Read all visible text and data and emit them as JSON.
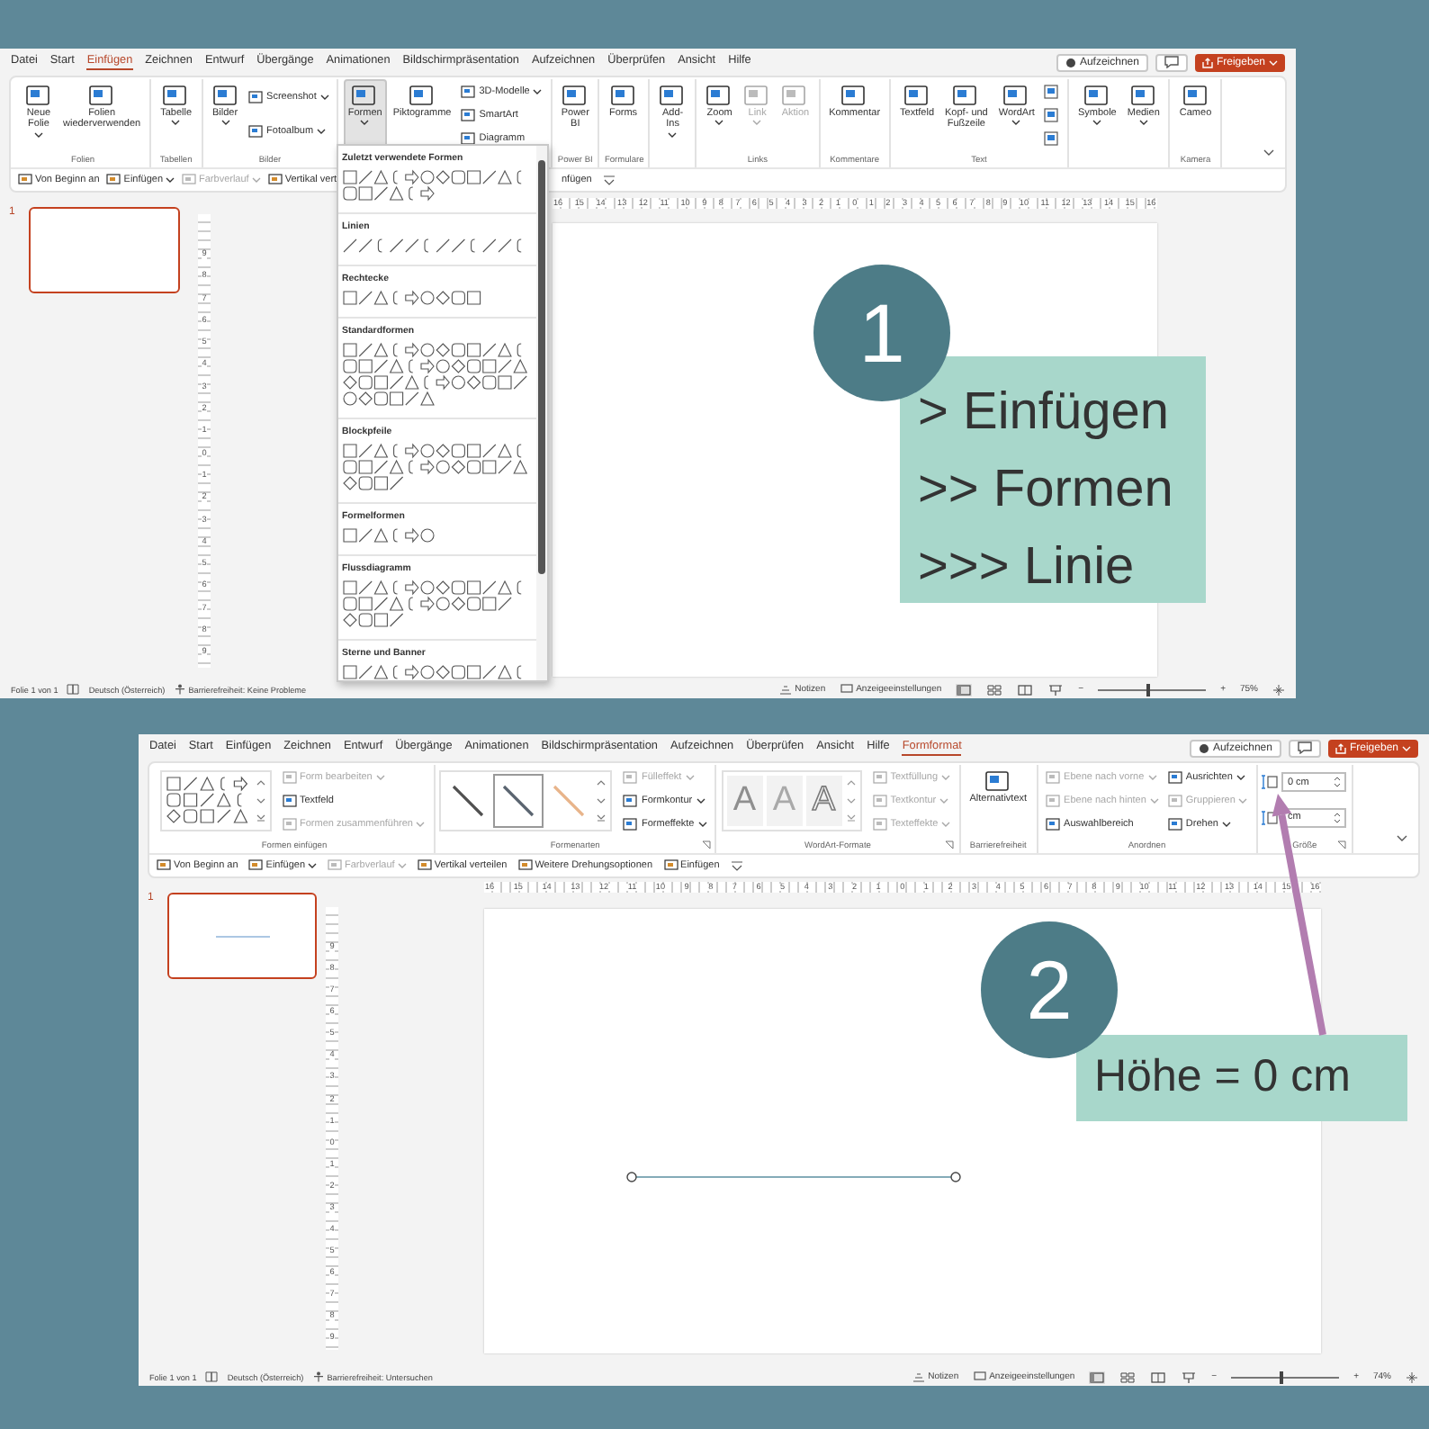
{
  "windows": [
    {
      "tabs": [
        {
          "label": "Datei",
          "selected": false
        },
        {
          "label": "Start",
          "selected": false
        },
        {
          "label": "Einfügen",
          "selected": true
        },
        {
          "label": "Zeichnen",
          "selected": false
        },
        {
          "label": "Entwurf",
          "selected": false
        },
        {
          "label": "Übergänge",
          "selected": false
        },
        {
          "label": "Animationen",
          "selected": false
        },
        {
          "label": "Bildschirmpräsentation",
          "selected": false
        },
        {
          "label": "Aufzeichnen",
          "selected": false
        },
        {
          "label": "Überprüfen",
          "selected": false
        },
        {
          "label": "Ansicht",
          "selected": false
        },
        {
          "label": "Hilfe",
          "selected": false
        }
      ],
      "record_button": "Aufzeichnen",
      "share_button": "Freigeben",
      "groups": [
        {
          "label": "Folien",
          "items": [
            {
              "kind": "large",
              "label": "Neue\nFolie",
              "menu": true,
              "expanded": false,
              "disabled": false
            },
            {
              "kind": "large",
              "label": "Folien\nwiederverwenden",
              "disabled": false
            }
          ]
        },
        {
          "label": "Tabellen",
          "items": [
            {
              "kind": "large",
              "label": "Tabelle",
              "menu": true,
              "expanded": false,
              "disabled": false
            }
          ]
        },
        {
          "label": "Bilder",
          "items": [
            {
              "kind": "large",
              "label": "Bilder",
              "menu": true,
              "expanded": false,
              "disabled": false
            },
            {
              "kind": "stack",
              "items": [
                {
                  "kind": "small",
                  "label": "Screenshot",
                  "menu": true,
                  "expanded": false,
                  "disabled": false
                },
                {
                  "kind": "small",
                  "label": "Fotoalbum",
                  "menu": true,
                  "expanded": false,
                  "disabled": false
                }
              ]
            }
          ]
        },
        {
          "items": [
            {
              "kind": "large",
              "label": "Formen",
              "menu": true,
              "expanded": true,
              "disabled": false
            },
            {
              "kind": "large",
              "label": "Piktogramme",
              "disabled": false
            },
            {
              "kind": "stack",
              "items": [
                {
                  "kind": "small",
                  "label": "3D-Modelle",
                  "menu": true,
                  "expanded": false,
                  "disabled": false
                },
                {
                  "kind": "small",
                  "label": "SmartArt",
                  "disabled": false
                },
                {
                  "kind": "small",
                  "label": "Diagramm",
                  "disabled": false
                }
              ]
            }
          ]
        },
        {
          "label": "Power BI",
          "items": [
            {
              "kind": "large",
              "label": "Power\nBI",
              "disabled": false
            }
          ]
        },
        {
          "label": "Formulare",
          "items": [
            {
              "kind": "large",
              "label": "Forms",
              "disabled": false
            }
          ]
        },
        {
          "items": [
            {
              "kind": "large",
              "label": "Add-\nIns",
              "menu": true,
              "expanded": false,
              "disabled": false
            }
          ]
        },
        {
          "label": "Links",
          "items": [
            {
              "kind": "large",
              "label": "Zoom",
              "menu": true,
              "expanded": false,
              "disabled": false
            },
            {
              "kind": "large",
              "label": "Link",
              "menu": true,
              "expanded": false,
              "disabled": true
            },
            {
              "kind": "large",
              "label": "Aktion",
              "disabled": true
            }
          ]
        },
        {
          "label": "Kommentare",
          "items": [
            {
              "kind": "large",
              "label": "Kommentar",
              "disabled": false
            }
          ]
        },
        {
          "label": "Text",
          "items": [
            {
              "kind": "large",
              "label": "Textfeld",
              "disabled": false
            },
            {
              "kind": "large",
              "label": "Kopf- und\nFußzeile",
              "disabled": false
            },
            {
              "kind": "large",
              "label": "WordArt",
              "menu": true,
              "expanded": false,
              "disabled": false
            },
            {
              "kind": "stack",
              "items": [
                {
                  "kind": "icon",
                  "disabled": false
                },
                {
                  "kind": "icon",
                  "disabled": false
                },
                {
                  "kind": "icon",
                  "disabled": false
                }
              ]
            }
          ]
        },
        {
          "items": [
            {
              "kind": "large",
              "label": "Symbole",
              "menu": true,
              "expanded": false,
              "disabled": false
            },
            {
              "kind": "large",
              "label": "Medien",
              "menu": true,
              "expanded": false,
              "disabled": false
            }
          ]
        },
        {
          "label": "Kamera",
          "items": [
            {
              "kind": "large",
              "label": "Cameo",
              "disabled": false
            }
          ]
        }
      ],
      "quick_access": [
        {
          "label": "Von Beginn an",
          "disabled": false
        },
        {
          "label": "Einfügen",
          "menu": true,
          "disabled": false
        },
        {
          "label": "Farbverlauf",
          "menu": true,
          "disabled": true
        },
        {
          "label": "Vertikal vert",
          "disabled": false
        },
        {
          "label": "nfügen",
          "disabled": false
        }
      ],
      "shapes_menu": {
        "sections": [
          "Zuletzt verwendete Formen",
          "Linien",
          "Rechtecke",
          "Standardformen",
          "Blockpfeile",
          "Formelformen",
          "Flussdiagramm",
          "Sterne und Banner"
        ]
      },
      "slide_number": "1",
      "ruler_h": [
        "16",
        "15",
        "14",
        "13",
        "12",
        "11",
        "10",
        "9",
        "8",
        "7",
        "6",
        "5",
        "4",
        "3",
        "2",
        "1",
        "0",
        "1",
        "2",
        "3",
        "4",
        "5",
        "6",
        "7",
        "8",
        "9",
        "10",
        "11",
        "12",
        "13",
        "14",
        "15",
        "16"
      ],
      "ruler_v": [
        "9",
        "8",
        "7",
        "6",
        "5",
        "4",
        "3",
        "2",
        "1",
        "0",
        "1",
        "2",
        "3",
        "4",
        "5",
        "6",
        "7",
        "8",
        "9"
      ],
      "callout": {
        "number": "1",
        "lines": [
          "> Einfügen",
          ">> Formen",
          ">>> Linie"
        ]
      },
      "status_bar": {
        "slide_info": "Folie 1 von 1",
        "language": "Deutsch (Österreich)",
        "accessibility": "Barrierefreiheit: Keine Probleme",
        "notes": "Notizen",
        "display_settings": "Anzeigeeinstellungen",
        "zoom_out": "−",
        "zoom_in": "+",
        "level": 0.45,
        "zoom": "75%"
      }
    },
    {
      "tabs": [
        {
          "label": "Datei",
          "selected": false
        },
        {
          "label": "Start",
          "selected": false
        },
        {
          "label": "Einfügen",
          "selected": false
        },
        {
          "label": "Zeichnen",
          "selected": false
        },
        {
          "label": "Entwurf",
          "selected": false
        },
        {
          "label": "Übergänge",
          "selected": false
        },
        {
          "label": "Animationen",
          "selected": false
        },
        {
          "label": "Bildschirmpräsentation",
          "selected": false
        },
        {
          "label": "Aufzeichnen",
          "selected": false
        },
        {
          "label": "Überprüfen",
          "selected": false
        },
        {
          "label": "Ansicht",
          "selected": false
        },
        {
          "label": "Hilfe",
          "selected": false
        },
        {
          "label": "Formformat",
          "selected": true
        }
      ],
      "record_button": "Aufzeichnen",
      "share_button": "Freigeben",
      "groups": [
        {
          "label": "Formen einfügen",
          "items": [
            {
              "kind": "gallery"
            },
            {
              "kind": "stack",
              "items": [
                {
                  "kind": "small",
                  "label": "Form bearbeiten",
                  "menu": true,
                  "expanded": false,
                  "disabled": true
                },
                {
                  "kind": "small",
                  "label": "Textfeld",
                  "disabled": false
                },
                {
                  "kind": "small",
                  "label": "Formen zusammenführen",
                  "menu": true,
                  "expanded": false,
                  "disabled": true
                }
              ]
            }
          ]
        },
        {
          "label": "Formenarten",
          "launcher": true,
          "items": [
            {
              "kind": "styles",
              "styles": [
                {
                  "color": "#505050",
                  "selected": false
                },
                {
                  "color": "#5a6470",
                  "selected": true
                },
                {
                  "color": "#e8b48a",
                  "selected": false
                }
              ]
            },
            {
              "kind": "stack",
              "items": [
                {
                  "kind": "small",
                  "label": "Fülleffekt",
                  "menu": true,
                  "expanded": false,
                  "disabled": true
                },
                {
                  "kind": "small",
                  "label": "Formkontur",
                  "menu": true,
                  "expanded": false,
                  "disabled": false
                },
                {
                  "kind": "small",
                  "label": "Formeffekte",
                  "menu": true,
                  "expanded": false,
                  "disabled": false
                }
              ]
            }
          ]
        },
        {
          "label": "WordArt-Formate",
          "launcher": true,
          "items": [
            {
              "kind": "wordart",
              "letters": [
                "A",
                "A",
                "A"
              ],
              "disabled": true
            },
            {
              "kind": "stack",
              "items": [
                {
                  "kind": "small",
                  "label": "Textfüllung",
                  "menu": true,
                  "expanded": false,
                  "disabled": true
                },
                {
                  "kind": "small",
                  "label": "Textkontur",
                  "menu": true,
                  "expanded": false,
                  "disabled": true
                },
                {
                  "kind": "small",
                  "label": "Texteffekte",
                  "menu": true,
                  "expanded": false,
                  "disabled": true
                }
              ]
            }
          ]
        },
        {
          "label": "Barrierefreiheit",
          "items": [
            {
              "kind": "large",
              "label": "Alternativtext",
              "disabled": false
            }
          ]
        },
        {
          "label": "Anordnen",
          "items": [
            {
              "kind": "stack",
              "items": [
                {
                  "kind": "small",
                  "label": "Ebene nach vorne",
                  "menu": true,
                  "expanded": false,
                  "disabled": true
                },
                {
                  "kind": "small",
                  "label": "Ebene nach hinten",
                  "menu": true,
                  "expanded": false,
                  "disabled": true
                },
                {
                  "kind": "small",
                  "label": "Auswahlbereich",
                  "disabled": false
                }
              ]
            },
            {
              "kind": "stack",
              "items": [
                {
                  "kind": "small",
                  "label": "Ausrichten",
                  "menu": true,
                  "expanded": false,
                  "disabled": false
                },
                {
                  "kind": "small",
                  "label": "Gruppieren",
                  "menu": true,
                  "expanded": false,
                  "disabled": true
                },
                {
                  "kind": "small",
                  "label": "Drehen",
                  "menu": true,
                  "expanded": false,
                  "disabled": false
                }
              ]
            }
          ]
        },
        {
          "label": "Größe",
          "launcher": true,
          "items": [
            {
              "kind": "stack",
              "items": [
                {
                  "kind": "field",
                  "value": "0 cm"
                },
                {
                  "kind": "field",
                  "value": "cm"
                }
              ]
            }
          ]
        }
      ],
      "quick_access": [
        {
          "label": "Von Beginn an",
          "disabled": false
        },
        {
          "label": "Einfügen",
          "menu": true,
          "disabled": false
        },
        {
          "label": "Farbverlauf",
          "menu": true,
          "disabled": true
        },
        {
          "label": "Vertikal verteilen",
          "disabled": false
        },
        {
          "label": "Weitere Drehungsoptionen",
          "disabled": false
        },
        {
          "label": "Einfügen",
          "disabled": false
        }
      ],
      "slide_number": "1",
      "ruler_h": [
        "16",
        "15",
        "14",
        "13",
        "12",
        "11",
        "10",
        "9",
        "8",
        "7",
        "6",
        "5",
        "4",
        "3",
        "2",
        "1",
        "0",
        "1",
        "2",
        "3",
        "4",
        "5",
        "6",
        "7",
        "8",
        "9",
        "10",
        "11",
        "12",
        "13",
        "14",
        "15",
        "16"
      ],
      "ruler_v": [
        "9",
        "8",
        "7",
        "6",
        "5",
        "4",
        "3",
        "2",
        "1",
        "0",
        "1",
        "2",
        "3",
        "4",
        "5",
        "6",
        "7",
        "8",
        "9"
      ],
      "callout": {
        "number": "2",
        "lines": [
          "Höhe = 0 cm"
        ]
      },
      "status_bar": {
        "slide_info": "Folie 1 von 1",
        "language": "Deutsch (Österreich)",
        "accessibility": "Barrierefreiheit: Untersuchen",
        "notes": "Notizen",
        "display_settings": "Anzeigeeinstellungen",
        "zoom_out": "−",
        "zoom_in": "+",
        "level": 0.45,
        "zoom": "74%"
      }
    }
  ]
}
